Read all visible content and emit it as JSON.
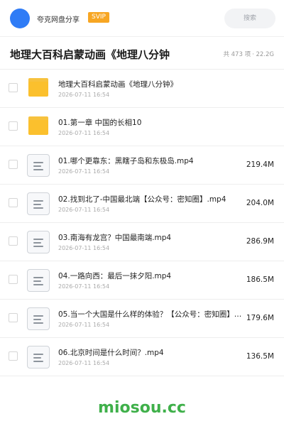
{
  "header": {
    "app_name": "夸克网盘分享",
    "badge": "SVIP",
    "search_placeholder": "搜索",
    "avatar_color": "#2f7cf6"
  },
  "folder": {
    "title": "地理大百科启蒙动画《地理八分钟",
    "count": "共 473 项",
    "total_size": "· 22.2G"
  },
  "items": [
    {
      "type": "folder",
      "icon": "folder-icon",
      "name": "地理大百科启蒙动画《地理八分钟》",
      "date": "2026-07-11 16:54",
      "size": ""
    },
    {
      "type": "folder",
      "icon": "folder-icon",
      "name": "01.第一章 中国的长相10",
      "date": "2026-07-11 16:54",
      "size": ""
    },
    {
      "type": "file",
      "icon": "file-icon",
      "name": "01.哪个更靠东：黑瞎子岛和东极岛.mp4",
      "date": "2026-07-11 16:54",
      "size": "219.4M"
    },
    {
      "type": "file",
      "icon": "file-icon",
      "name": "02.找到北了-中国最北端【公众号：密知圈】.mp4",
      "date": "2026-07-11 16:54",
      "size": "204.0M"
    },
    {
      "type": "file",
      "icon": "file-icon",
      "name": "03.南海有龙宫？中国最南端.mp4",
      "date": "2026-07-11 16:54",
      "size": "286.9M"
    },
    {
      "type": "file",
      "icon": "file-icon",
      "name": "04.一路向西：最后一抹夕阳.mp4",
      "date": "2026-07-11 16:54",
      "size": "186.5M"
    },
    {
      "type": "file",
      "icon": "file-icon",
      "name": "05.当一个大国是什么样的体验？【公众号：密知圈】…",
      "date": "2026-07-11 16:54",
      "size": "179.6M"
    },
    {
      "type": "file",
      "icon": "file-icon",
      "name": "06.北京时间是什么时间？.mp4",
      "date": "2026-07-11 16:54",
      "size": "136.5M"
    }
  ],
  "watermark": "miosou.cc",
  "colors": {
    "accent": "#2f7cf6",
    "badge": "#f7a623",
    "folder": "#fbc02d",
    "watermark": "#3fb04a"
  }
}
